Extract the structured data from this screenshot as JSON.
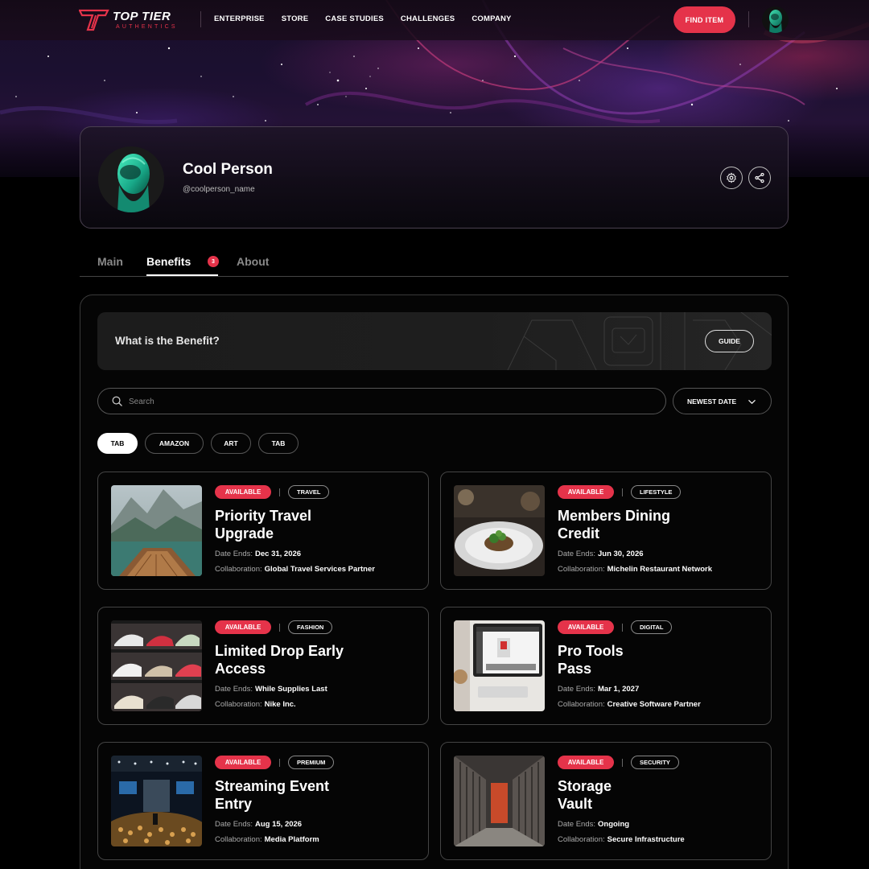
{
  "brand": {
    "title": "TOP TIER",
    "subtitle": "AUTHENTICS"
  },
  "nav": {
    "links": [
      "ENTERPRISE",
      "STORE",
      "CASE STUDIES",
      "CHALLENGES",
      "COMPANY"
    ],
    "cta": "FIND ITEM"
  },
  "profile": {
    "name": "Cool Person",
    "handle": "@coolperson_name"
  },
  "tabs": [
    {
      "label": "Main"
    },
    {
      "label": "Benefits",
      "badge": "3"
    },
    {
      "label": "About"
    }
  ],
  "banner": {
    "title": "What is the Benefit?",
    "button": "GUIDE"
  },
  "search": {
    "placeholder": "Search"
  },
  "sort": {
    "label": "NEWEST DATE"
  },
  "chips": [
    "TAB",
    "AMAZON",
    "ART",
    "TAB"
  ],
  "labels": {
    "date": "Date Ends:",
    "collab": "Collaboration:"
  },
  "benefits": [
    {
      "status": "AVAILABLE",
      "category": "TRAVEL",
      "title_1": "Priority Travel",
      "title_2": "Upgrade",
      "date": "Dec 31, 2026",
      "collab": "Global Travel Services Partner"
    },
    {
      "status": "AVAILABLE",
      "category": "LIFESTYLE",
      "title_1": "Members Dining",
      "title_2": "Credit",
      "date": "Jun 30, 2026",
      "collab": "Michelin Restaurant Network"
    },
    {
      "status": "AVAILABLE",
      "category": "FASHION",
      "title_1": "Limited Drop Early",
      "title_2": "Access",
      "date": "While Supplies Last",
      "collab": "Nike Inc."
    },
    {
      "status": "AVAILABLE",
      "category": "DIGITAL",
      "title_1": "Pro Tools",
      "title_2": "Pass",
      "date": "Mar 1, 2027",
      "collab": "Creative Software Partner"
    },
    {
      "status": "AVAILABLE",
      "category": "PREMIUM",
      "title_1": "Streaming Event",
      "title_2": "Entry",
      "date": "Aug 15, 2026",
      "collab": "Media Platform"
    },
    {
      "status": "AVAILABLE",
      "category": "SECURITY",
      "title_1": "Storage",
      "title_2": "Vault",
      "date": "Ongoing",
      "collab": "Secure Infrastructure"
    }
  ],
  "colors": {
    "accent": "#e5334a",
    "background": "#000000",
    "border": "#444444"
  }
}
